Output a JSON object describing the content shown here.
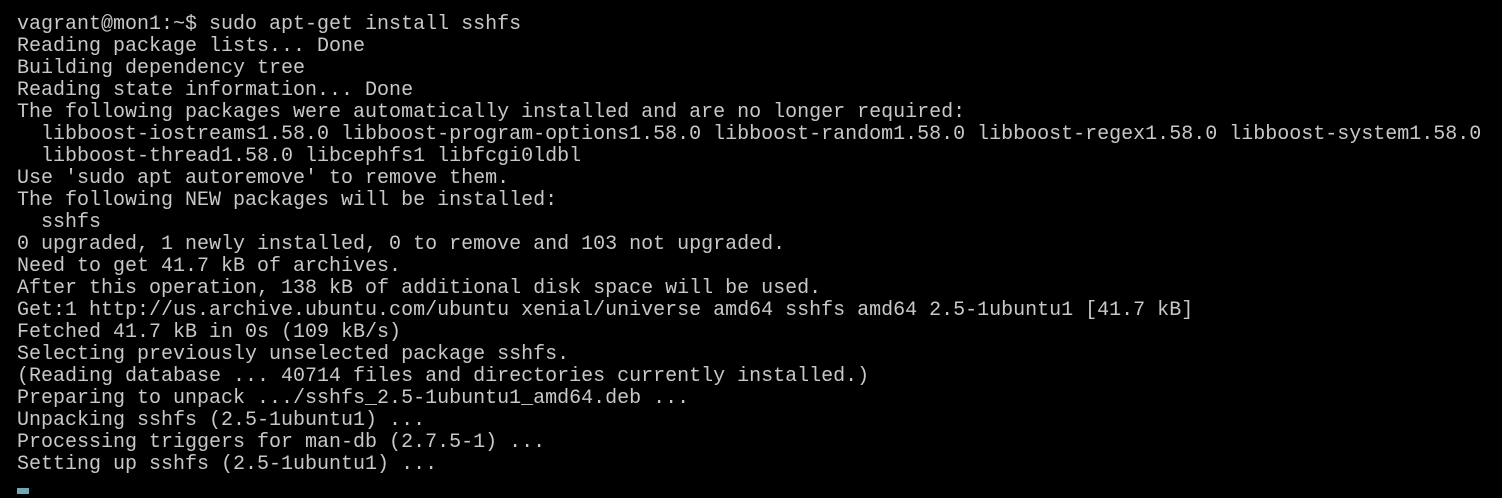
{
  "terminal": {
    "text_color": "#c8c8c8",
    "cursor_color": "#6ea9b4",
    "lines": [
      "vagrant@mon1:~$ sudo apt-get install sshfs",
      "Reading package lists... Done",
      "Building dependency tree",
      "Reading state information... Done",
      "The following packages were automatically installed and are no longer required:",
      "  libboost-iostreams1.58.0 libboost-program-options1.58.0 libboost-random1.58.0 libboost-regex1.58.0 libboost-system1.58.0",
      "  libboost-thread1.58.0 libcephfs1 libfcgi0ldbl",
      "Use 'sudo apt autoremove' to remove them.",
      "The following NEW packages will be installed:",
      "  sshfs",
      "0 upgraded, 1 newly installed, 0 to remove and 103 not upgraded.",
      "Need to get 41.7 kB of archives.",
      "After this operation, 138 kB of additional disk space will be used.",
      "Get:1 http://us.archive.ubuntu.com/ubuntu xenial/universe amd64 sshfs amd64 2.5-1ubuntu1 [41.7 kB]",
      "Fetched 41.7 kB in 0s (109 kB/s)",
      "Selecting previously unselected package sshfs.",
      "(Reading database ... 40714 files and directories currently installed.)",
      "Preparing to unpack .../sshfs_2.5-1ubuntu1_amd64.deb ...",
      "Unpacking sshfs (2.5-1ubuntu1) ...",
      "Processing triggers for man-db (2.7.5-1) ...",
      "Setting up sshfs (2.5-1ubuntu1) ..."
    ]
  }
}
